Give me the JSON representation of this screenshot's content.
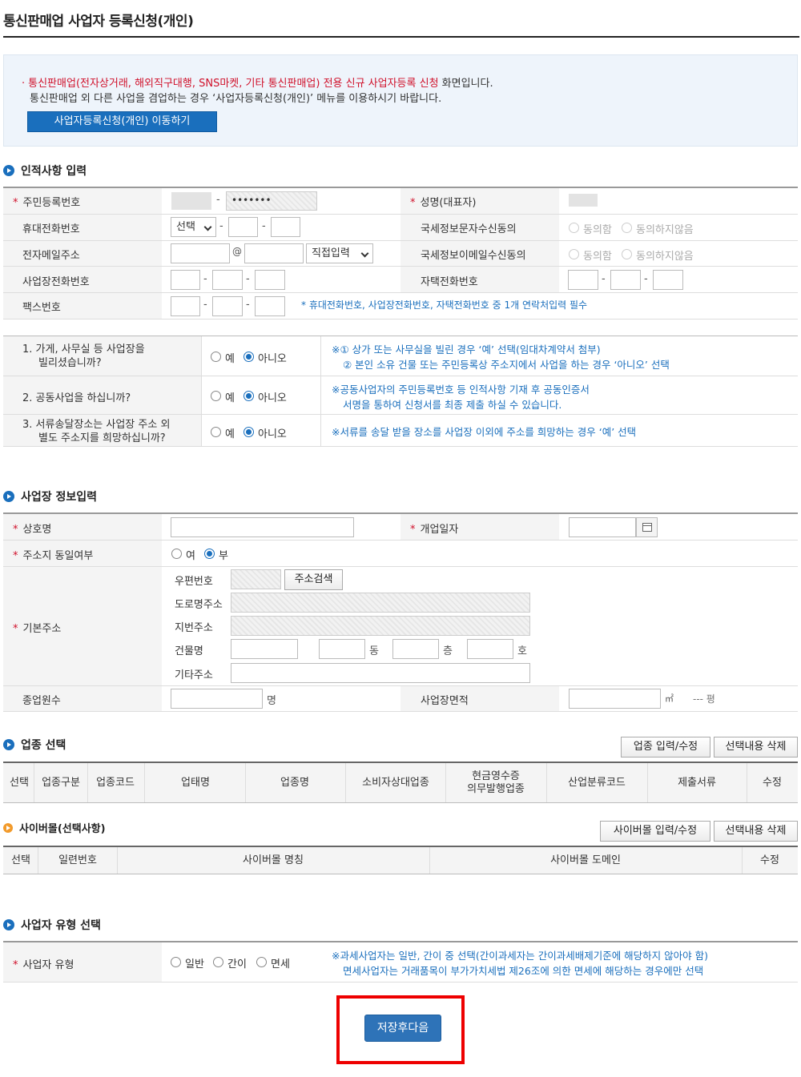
{
  "page_title": "통신판매업 사업자 등록신청(개인)",
  "notice": {
    "bullet": "·",
    "highlight": "통신판매업(전자상거래, 해외직구대행, SNS마켓, 기타 통신판매업) 전용 신규 사업자등록 신청",
    "tail": " 화면입니다.",
    "line2": "통신판매업 외 다른 사업을 겸업하는 경우 ‘사업자등록신청(개인)’ 메뉴를 이용하시기 바랍니다.",
    "button": "사업자등록신청(개인) 이동하기"
  },
  "personal": {
    "heading": "인적사항 입력",
    "rrn_label": "주민등록번호",
    "rrn_masked": "•••••••",
    "name_label": "성명(대표자)",
    "mobile_label": "휴대전화번호",
    "mobile_select": "선택",
    "nts_sms_label": "국세정보문자수신동의",
    "email_label": "전자메일주소",
    "email_at": "@",
    "email_select": "직접입력",
    "nts_email_label": "국세정보이메일수신동의",
    "agree": "동의함",
    "disagree": "동의하지않음",
    "biz_phone_label": "사업장전화번호",
    "home_phone_label": "자택전화번호",
    "fax_label": "팩스번호",
    "contact_note": "* 휴대전화번호, 사업장전화번호, 자택전화번호 중 1개 연락처입력 필수",
    "dash": "-"
  },
  "questions": {
    "yes": "예",
    "no": "아니오",
    "q1": "1. 가게, 사무실 등 사업장을\n빌리셨습니까?",
    "q1_line1": "1. 가게, 사무실 등 사업장을",
    "q1_line2": "빌리셨습니까?",
    "q1_note1": "※① 상가 또는 사무실을 빌린 경우 ‘예’ 선택(임대차계약서 첨부)",
    "q1_note2": "② 본인 소유 건물 또는 주민등록상 주소지에서 사업을 하는 경우 ‘아니오’ 선택",
    "q2": "2. 공동사업을 하십니까?",
    "q2_note1": "※공동사업자의 주민등록번호 등 인적사항 기재 후 공동인증서",
    "q2_note2": "서명을 통하여 신청서를 최종 제출 하실 수 있습니다.",
    "q3_line1": "3. 서류송달장소는 사업장 주소 외",
    "q3_line2": "별도 주소지를 희망하십니까?",
    "q3_note": "※서류를 송달 받을 장소를 사업장 이외에 주소를 희망하는 경우 ‘예’ 선택"
  },
  "business": {
    "heading": "사업장 정보입력",
    "trade_name_label": "상호명",
    "open_date_label": "개업일자",
    "same_addr_label": "주소지 동일여부",
    "same_yes": "여",
    "same_no": "부",
    "base_addr_label": "기본주소",
    "zip_label": "우편번호",
    "addr_search": "주소검색",
    "road_label": "도로명주소",
    "lot_label": "지번주소",
    "building_label": "건물명",
    "dong": "동",
    "floor": "층",
    "ho": "호",
    "etc_label": "기타주소",
    "employees_label": "종업원수",
    "employees_unit": "명",
    "area_label": "사업장면적",
    "area_unit": "㎡",
    "pyeong": "--- 평"
  },
  "industry": {
    "heading": "업종 선택",
    "btn_edit": "업종 입력/수정",
    "btn_delete": "선택내용 삭제",
    "columns": [
      "선택",
      "업종구분",
      "업종코드",
      "업태명",
      "업종명",
      "소비자상대업종",
      "현금영수증\n의무발행업종",
      "산업분류코드",
      "제출서류",
      "수정"
    ],
    "col_cash_1": "현금영수증",
    "col_cash_2": "의무발행업종"
  },
  "cybermall": {
    "heading": "사이버몰(선택사항)",
    "btn_edit": "사이버몰 입력/수정",
    "btn_delete": "선택내용 삭제",
    "columns": [
      "선택",
      "일련번호",
      "사이버몰 명칭",
      "사이버몰 도메인",
      "수정"
    ]
  },
  "biztype": {
    "heading": "사업자 유형 선택",
    "label": "사업자 유형",
    "opt_general": "일반",
    "opt_simple": "간이",
    "opt_exempt": "면세",
    "note1": "※과세사업자는 일반, 간이 중 선택(간이과세자는 간이과세배제기준에 해당하지 않아야 함)",
    "note2": "면세사업자는 거래품목이 부가가치세법 제26조에 의한 면세에 해당하는 경우에만 선택"
  },
  "save_button": "저장후다음",
  "colors": {
    "accent": "#1a6fbd",
    "required": "#d0102a",
    "highlight_box": "#ee0000"
  }
}
